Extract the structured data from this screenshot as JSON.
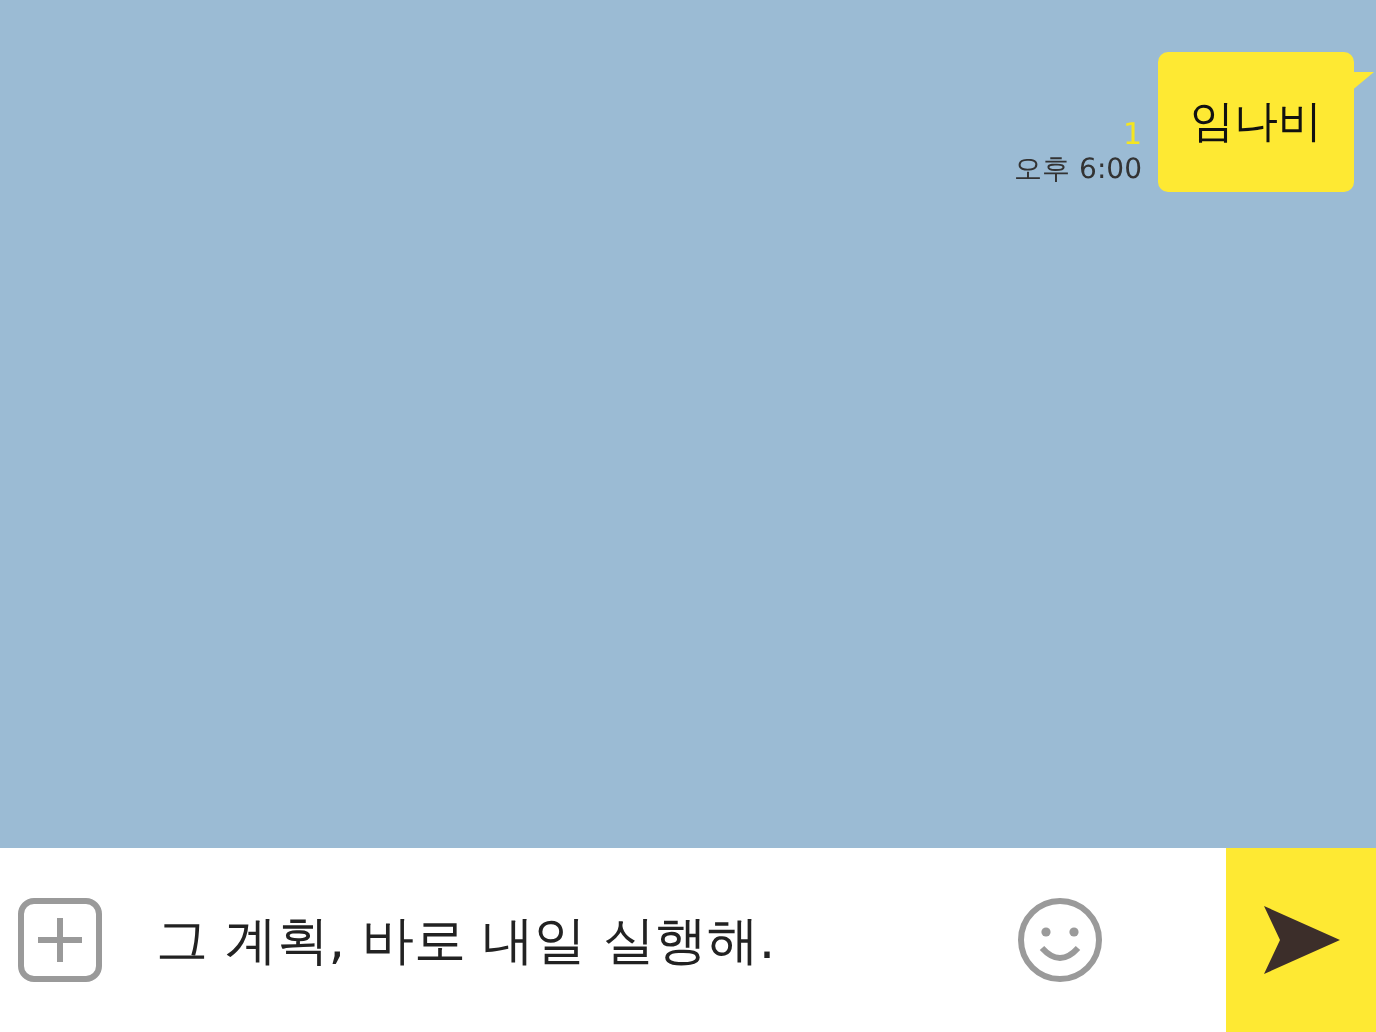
{
  "messages": [
    {
      "text": "임나비",
      "unread": "1",
      "time": "오후 6:00",
      "outgoing": true
    }
  ],
  "composer": {
    "value": "그 계획, 바로 내일 실행해."
  }
}
